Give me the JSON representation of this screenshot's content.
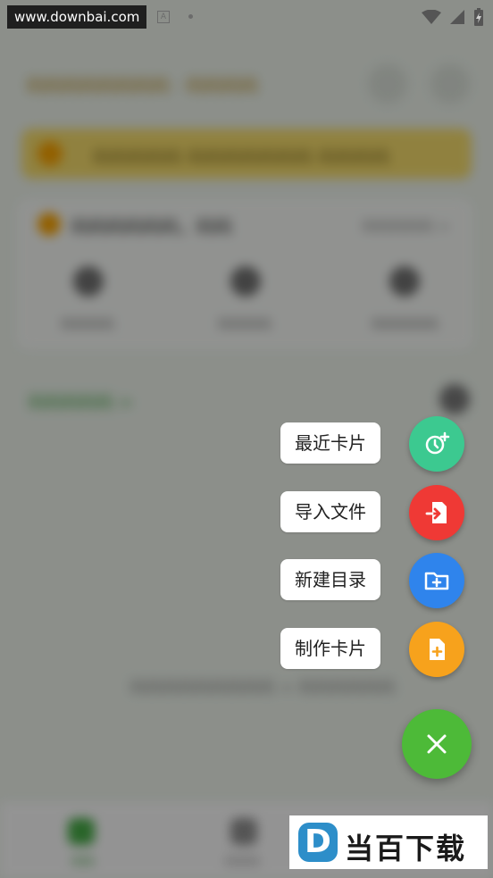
{
  "status_bar": {
    "watermark": "www.downbai.com",
    "badge": "A"
  },
  "background": {
    "header_title": "码码码码码码码码 · 码码码码",
    "banner_text": "码码码码码 码码码码码码码 码码码码",
    "card_title": "码码码码码码，码码",
    "card_more": "码码码码码 >",
    "card_items": [
      "码码码码",
      "码码码码",
      "码码码码码"
    ],
    "section_link": "码码码码码 >",
    "empty_text": "码码码码码码码码码 + 码码码码码码",
    "tabs": [
      "码码",
      "码码码"
    ]
  },
  "fab_menu": {
    "items": [
      {
        "label": "最近卡片",
        "icon": "recent-card-icon",
        "color": "#3cc990"
      },
      {
        "label": "导入文件",
        "icon": "import-file-icon",
        "color": "#ef3935"
      },
      {
        "label": "新建目录",
        "icon": "new-folder-icon",
        "color": "#2f84ec"
      },
      {
        "label": "制作卡片",
        "icon": "make-card-icon",
        "color": "#f7a21c"
      }
    ],
    "close_icon": "close-icon",
    "close_color": "#4dba38"
  },
  "watermark_logo": {
    "letter": "D",
    "text": "当百下载"
  }
}
